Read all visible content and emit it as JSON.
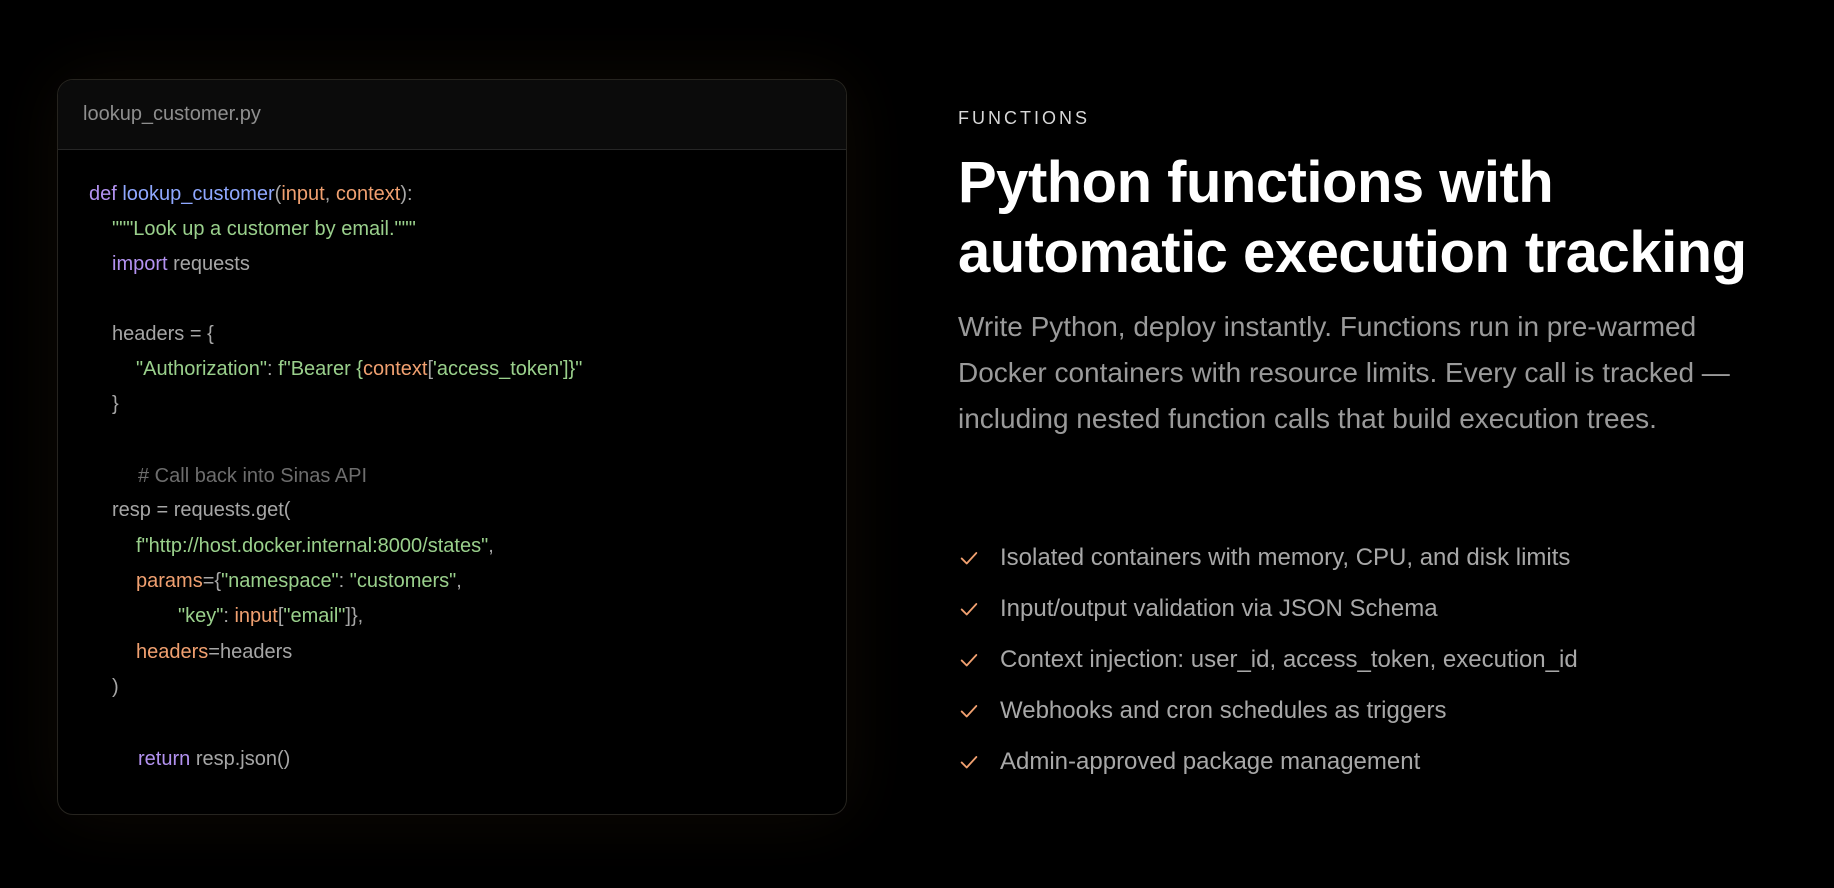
{
  "code_card": {
    "filename": "lookup_customer.py",
    "lines": [
      [
        {
          "t": "def ",
          "c": "kw"
        },
        {
          "t": "lookup_customer",
          "c": "fn"
        },
        {
          "t": "(",
          "c": "plain"
        },
        {
          "t": "input",
          "c": "param"
        },
        {
          "t": ", ",
          "c": "plain"
        },
        {
          "t": "context",
          "c": "param"
        },
        {
          "t": "):",
          "c": "plain"
        }
      ],
      [
        {
          "t": "\"\"\"Look up a customer by email.\"\"\"",
          "c": "str"
        }
      ],
      [
        {
          "t": "import ",
          "c": "kw"
        },
        {
          "t": "requests",
          "c": "plain"
        }
      ],
      [
        {
          "t": "headers = {",
          "c": "plain"
        }
      ],
      [
        {
          "t": "\"Authorization\"",
          "c": "str"
        },
        {
          "t": ": ",
          "c": "plain"
        },
        {
          "t": "f\"Bearer {",
          "c": "str"
        },
        {
          "t": "context",
          "c": "param"
        },
        {
          "t": "[",
          "c": "plain"
        },
        {
          "t": "'access_token'",
          "c": "str"
        },
        {
          "t": "]}\"",
          "c": "str"
        }
      ],
      [
        {
          "t": "}",
          "c": "plain"
        }
      ],
      [
        {
          "t": "# Call back into Sinas API",
          "c": "cmt"
        }
      ],
      [
        {
          "t": "resp = requests.get(",
          "c": "plain"
        }
      ],
      [
        {
          "t": "f\"http://host.docker.internal:8000/states\"",
          "c": "str"
        },
        {
          "t": ",",
          "c": "plain"
        }
      ],
      [
        {
          "t": "params",
          "c": "param"
        },
        {
          "t": "={",
          "c": "plain"
        },
        {
          "t": "\"namespace\"",
          "c": "str"
        },
        {
          "t": ": ",
          "c": "plain"
        },
        {
          "t": "\"customers\"",
          "c": "str"
        },
        {
          "t": ",",
          "c": "plain"
        }
      ],
      [
        {
          "t": "\"key\"",
          "c": "str"
        },
        {
          "t": ": ",
          "c": "plain"
        },
        {
          "t": "input",
          "c": "param"
        },
        {
          "t": "[",
          "c": "plain"
        },
        {
          "t": "\"email\"",
          "c": "str"
        },
        {
          "t": "]},",
          "c": "plain"
        }
      ],
      [
        {
          "t": "headers",
          "c": "param"
        },
        {
          "t": "=headers",
          "c": "plain"
        }
      ],
      [
        {
          "t": ")",
          "c": "plain"
        }
      ],
      [
        {
          "t": "return ",
          "c": "kw"
        },
        {
          "t": "resp.json()",
          "c": "plain"
        }
      ]
    ]
  },
  "content": {
    "eyebrow": "FUNCTIONS",
    "headline": "Python functions with automatic execution tracking",
    "description": "Write Python, deploy instantly. Functions run in pre-warmed Docker containers with resource limits. Every call is tracked — including nested function calls that build execution trees.",
    "features": [
      "Isolated containers with memory, CPU, and disk limits",
      "Input/output validation via JSON Schema",
      "Context injection: user_id, access_token, execution_id",
      "Webhooks and cron schedules as triggers",
      "Admin-approved package management"
    ]
  },
  "colors": {
    "background": "#000000",
    "keyword": "#b392f0",
    "function": "#8fa8ff",
    "parameter": "#f0a070",
    "string": "#9ad08c",
    "comment": "#6d6d6d",
    "check": "#f0a070"
  },
  "icons": {
    "feature_bullet": "check-icon"
  }
}
